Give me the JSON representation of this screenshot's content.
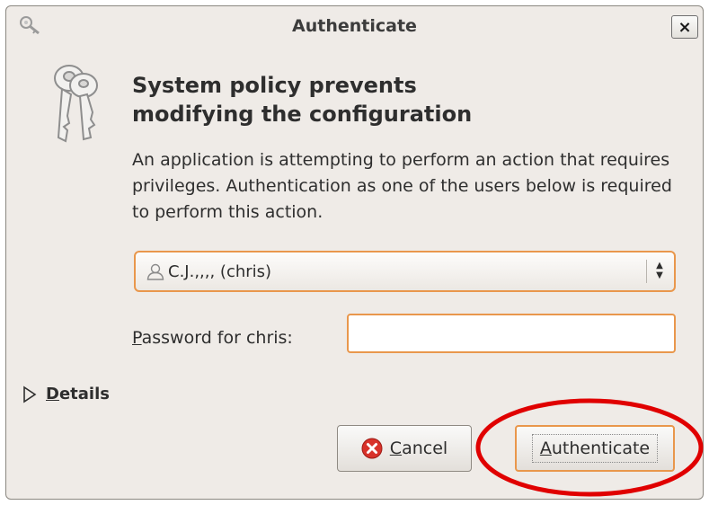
{
  "window": {
    "title": "Authenticate",
    "close_label": "×"
  },
  "heading": {
    "line1": "System policy prevents",
    "line2": "modifying the configuration"
  },
  "description": "An application is attempting to perform an action that requires privileges. Authentication as one of the users below is required to perform this action.",
  "user_select": {
    "selected": "C.J.,,,, (chris)"
  },
  "password": {
    "mnemonic": "P",
    "label_rest": "assword for chris:",
    "value": ""
  },
  "details": {
    "mnemonic": "D",
    "label_rest": "etails"
  },
  "buttons": {
    "cancel_mnemonic": "C",
    "cancel_rest": "ancel",
    "auth_mnemonic": "A",
    "auth_rest": "uthenticate"
  },
  "colors": {
    "focus_accent": "#e9974c",
    "highlight_circle": "#e00000",
    "cancel_icon": "#d8322a"
  }
}
